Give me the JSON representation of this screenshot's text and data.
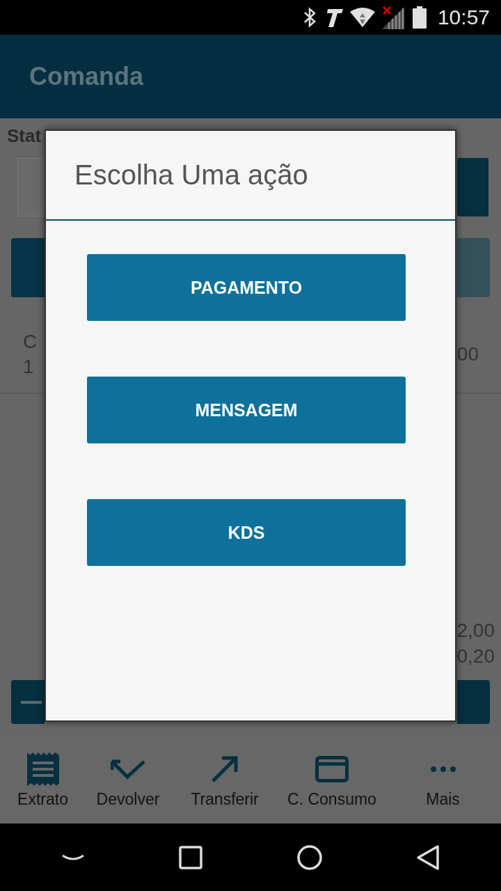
{
  "status_bar": {
    "time": "10:57"
  },
  "app_bar": {
    "title": "Comanda"
  },
  "background": {
    "section_label": "Stat",
    "row_label": "C",
    "row_value": "1",
    "row_amount": "00",
    "totals": [
      "2,00",
      "0,20"
    ]
  },
  "dialog": {
    "title": "Escolha Uma ação",
    "actions": [
      "PAGAMENTO",
      "MENSAGEM",
      "KDS"
    ]
  },
  "bottom_nav": [
    {
      "label": "Extrato",
      "kind": "receipt"
    },
    {
      "label": "Devolver",
      "kind": "return"
    },
    {
      "label": "Transferir",
      "kind": "transfer"
    },
    {
      "label": "C. Consumo",
      "kind": "card"
    },
    {
      "label": "Mais",
      "kind": "more"
    }
  ]
}
